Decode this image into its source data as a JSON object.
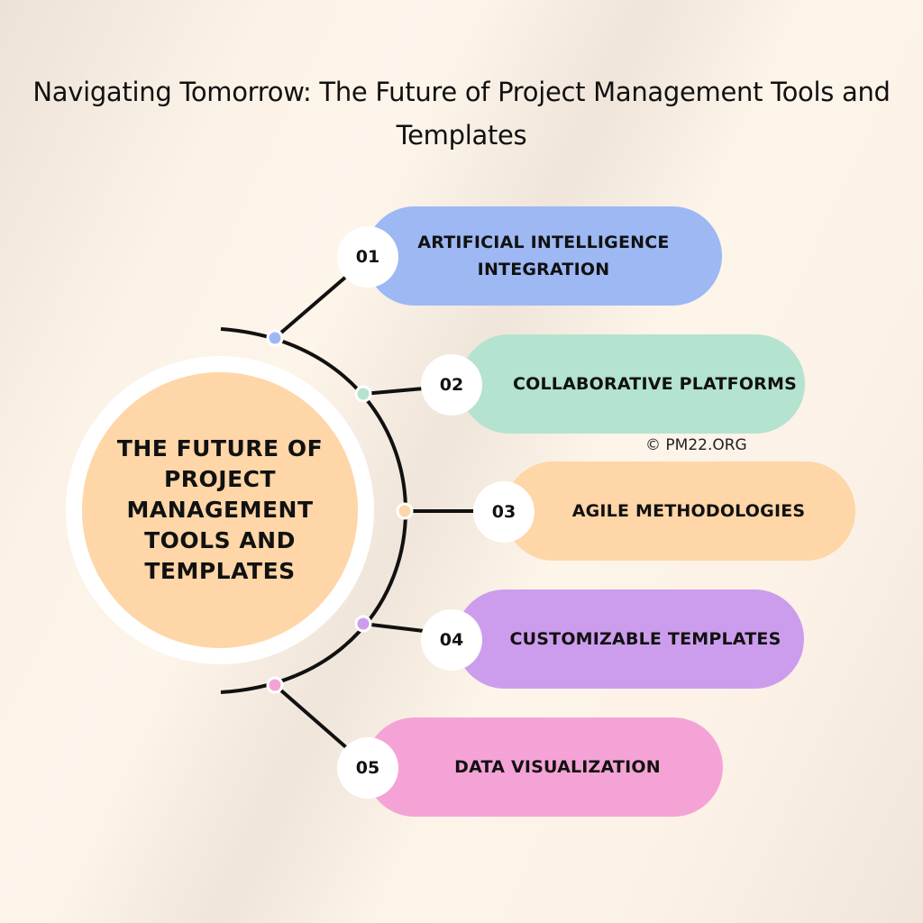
{
  "title": "Navigating Tomorrow: The Future of Project Management Tools and Templates",
  "hub": {
    "label": "THE FUTURE OF PROJECT MANAGEMENT TOOLS AND TEMPLATES",
    "color": "#fed6a7"
  },
  "watermark": "© PM22.ORG",
  "items": [
    {
      "number": "01",
      "label": "ARTIFICIAL INTELLIGENCE INTEGRATION",
      "color": "#9db8f3"
    },
    {
      "number": "02",
      "label": "COLLABORATIVE PLATFORMS",
      "color": "#b4e3d0"
    },
    {
      "number": "03",
      "label": "AGILE METHODOLOGIES",
      "color": "#fed6a7"
    },
    {
      "number": "04",
      "label": "CUSTOMIZABLE TEMPLATES",
      "color": "#cd9ded"
    },
    {
      "number": "05",
      "label": "DATA VISUALIZATION",
      "color": "#f5a3d6"
    }
  ]
}
